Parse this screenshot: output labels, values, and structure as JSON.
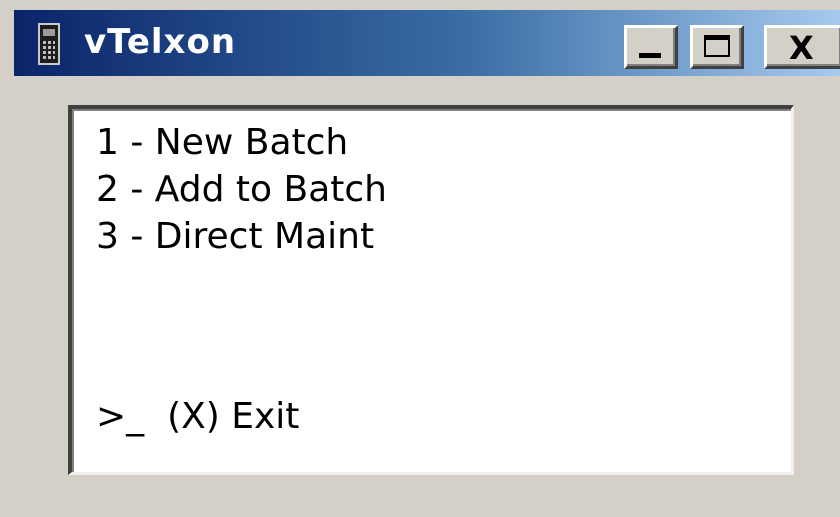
{
  "window": {
    "title": "vTelxon",
    "icon": "calculator-icon",
    "controls": {
      "minimize": "minimize-icon",
      "maximize": "maximize-icon",
      "close": "close-icon",
      "close_glyph": "X"
    }
  },
  "terminal": {
    "menu": [
      {
        "label": "1 - New Batch"
      },
      {
        "label": "2 - Add to Batch"
      },
      {
        "label": "3 - Direct Maint"
      }
    ],
    "prompt": ">_",
    "exit_label": "(X) Exit"
  },
  "colors": {
    "titlebar_start": "#0a246a",
    "titlebar_end": "#a6caf0",
    "window_bg": "#d4d0c8",
    "terminal_bg": "#ffffff",
    "text": "#000000"
  }
}
